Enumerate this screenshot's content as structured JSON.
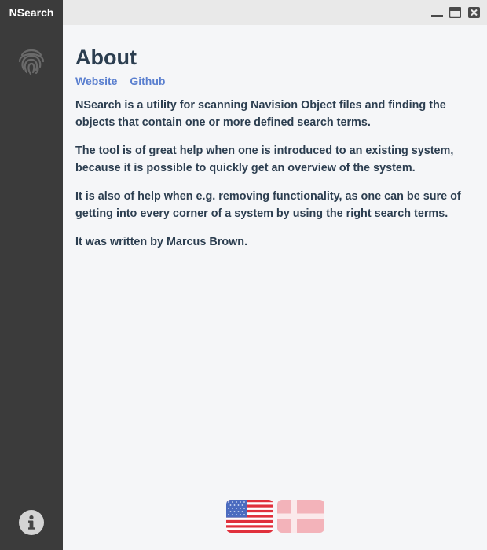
{
  "app": {
    "title": "NSearch"
  },
  "sidebar": {
    "nav_icon": "fingerprint-icon",
    "info_icon": "info-icon"
  },
  "window_controls": {
    "minimize": "minimize-icon",
    "maximize": "maximize-icon",
    "close": "close-icon"
  },
  "about": {
    "title": "About",
    "links": [
      {
        "label": "Website"
      },
      {
        "label": "Github"
      }
    ],
    "paragraphs": [
      "NSearch is a utility for scanning Navision Object files and finding the objects that contain one or more defined search terms.",
      "The tool is of great help when one is introduced to an existing system, because it is possible to quickly get an overview of the system.",
      "It is also of help when e.g. removing functionality, as one can be sure of getting into every corner of a system by using the right search terms.",
      "It was written by Marcus Brown."
    ]
  },
  "languages": [
    {
      "name": "english-flag",
      "active": true
    },
    {
      "name": "danish-flag",
      "active": false
    }
  ],
  "colors": {
    "sidebar": "#3b3b3b",
    "titlebar": "#e9e9e9",
    "content_bg": "#f5f6f8",
    "text": "#2c3e50",
    "link": "#5a7fcf"
  }
}
